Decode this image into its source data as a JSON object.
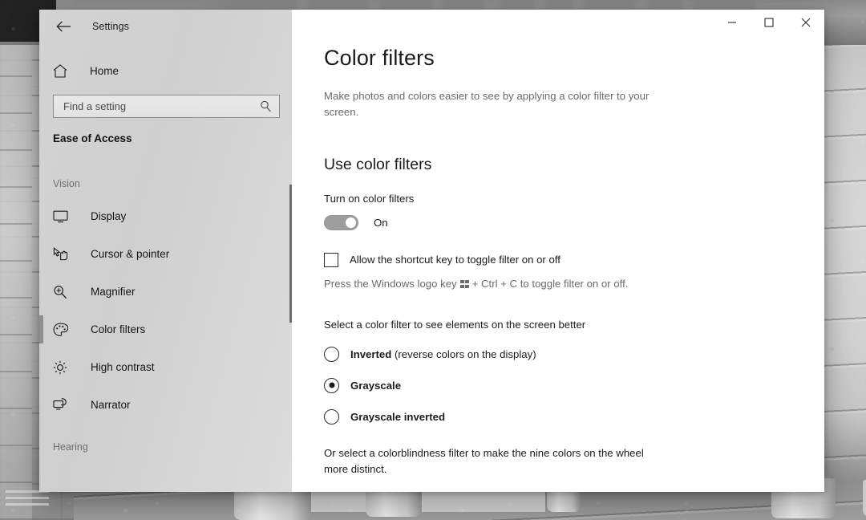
{
  "window": {
    "app_title": "Settings",
    "back_icon": "back-arrow-icon",
    "minimize_label": "—",
    "maximize_label": "□",
    "close_label": "✕"
  },
  "nav": {
    "home_label": "Home",
    "home_icon": "home-icon",
    "search": {
      "placeholder": "Find a setting",
      "value": "",
      "icon": "search-icon"
    },
    "category_heading": "Ease of Access",
    "group_label": "Vision",
    "items": [
      {
        "label": "Display",
        "icon": "monitor-icon",
        "selected": false
      },
      {
        "label": "Cursor & pointer",
        "icon": "cursor-pointer-icon",
        "selected": false
      },
      {
        "label": "Magnifier",
        "icon": "magnifier-icon",
        "selected": false
      },
      {
        "label": "Color filters",
        "icon": "palette-icon",
        "selected": true
      },
      {
        "label": "High contrast",
        "icon": "brightness-icon",
        "selected": false
      },
      {
        "label": "Narrator",
        "icon": "narrator-icon",
        "selected": false
      }
    ],
    "group_label_bottom": "Hearing"
  },
  "content": {
    "title": "Color filters",
    "description": "Make photos and colors easier to see by applying a color filter to your screen.",
    "section_title": "Use color filters",
    "toggle": {
      "label": "Turn on color filters",
      "state": "On",
      "checked": true
    },
    "shortcut_checkbox": {
      "label": "Allow the shortcut key to toggle filter on or off",
      "checked": false
    },
    "shortcut_hint_before": "Press the Windows logo key",
    "shortcut_hint_after": "+ Ctrl + C to toggle filter on or off.",
    "windows_key_icon": "windows-logo-icon",
    "select_prompt": "Select a color filter to see elements on the screen better",
    "filters": [
      {
        "name": "Inverted",
        "detail": " (reverse colors on the display)",
        "selected": false
      },
      {
        "name": "Grayscale",
        "detail": "",
        "selected": true
      },
      {
        "name": "Grayscale inverted",
        "detail": "",
        "selected": false
      }
    ],
    "closing_note": "Or select a colorblindness filter to make the nine colors on the wheel more distinct."
  },
  "colors": {
    "nav_background": "#d3d3d3",
    "content_background": "#ffffff",
    "accent_selection": "#8e8e8e",
    "toggle_on": "#9d9d9d",
    "text_primary": "#1b1b1b",
    "text_secondary": "#6b6b6b"
  }
}
